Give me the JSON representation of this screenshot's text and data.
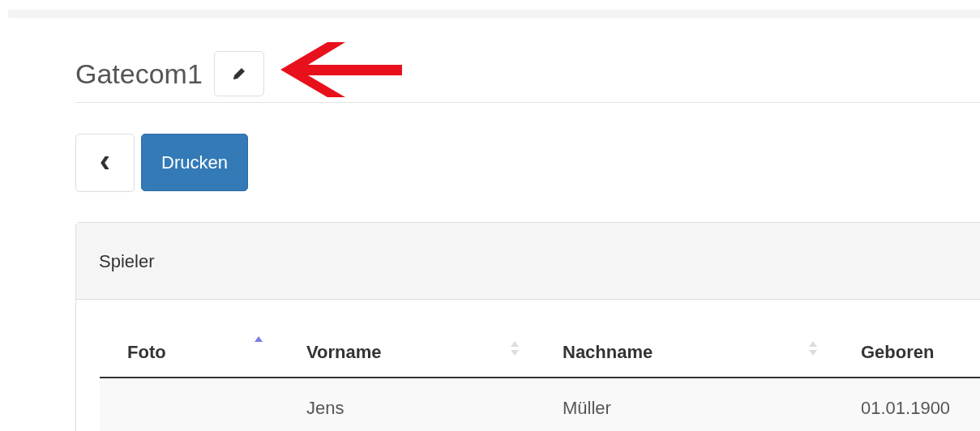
{
  "title": "Gatecom1",
  "toolbar": {
    "back_label": "‹",
    "print_button": "Drucken"
  },
  "panel": {
    "heading": "Spieler",
    "table": {
      "columns": [
        {
          "label": "Foto",
          "sorted": true
        },
        {
          "label": "Vorname",
          "sorted": false
        },
        {
          "label": "Nachname",
          "sorted": false
        },
        {
          "label": "Geboren"
        }
      ],
      "rows": [
        {
          "cells": [
            "",
            "Jens",
            "Müller",
            "01.01.1900"
          ]
        }
      ]
    }
  }
}
